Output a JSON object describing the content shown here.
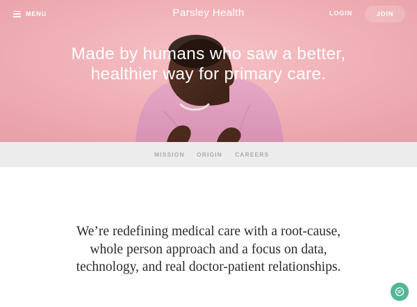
{
  "header": {
    "menu_label": "MENU",
    "brand": "Parsley Health",
    "login_label": "LOGIN",
    "join_label": "JOIN"
  },
  "hero": {
    "headline": "Made by humans who saw a better, healthier way for primary care."
  },
  "subnav": {
    "items": [
      {
        "label": "MISSION"
      },
      {
        "label": "ORIGIN"
      },
      {
        "label": "CAREERS"
      }
    ]
  },
  "main": {
    "statement": "We’re redefining medical care with a root-cause, whole person approach and a focus on data, technology, and real doctor-patient relationships."
  },
  "icons": {
    "menu": "hamburger-icon",
    "chat": "chat-bubble-icon"
  },
  "colors": {
    "hero_background": "#efabb1",
    "subnav_background": "#ececec",
    "subnav_text": "#a9a9a9",
    "chat_button": "#52b69a",
    "body_text": "#2a2a2a"
  }
}
